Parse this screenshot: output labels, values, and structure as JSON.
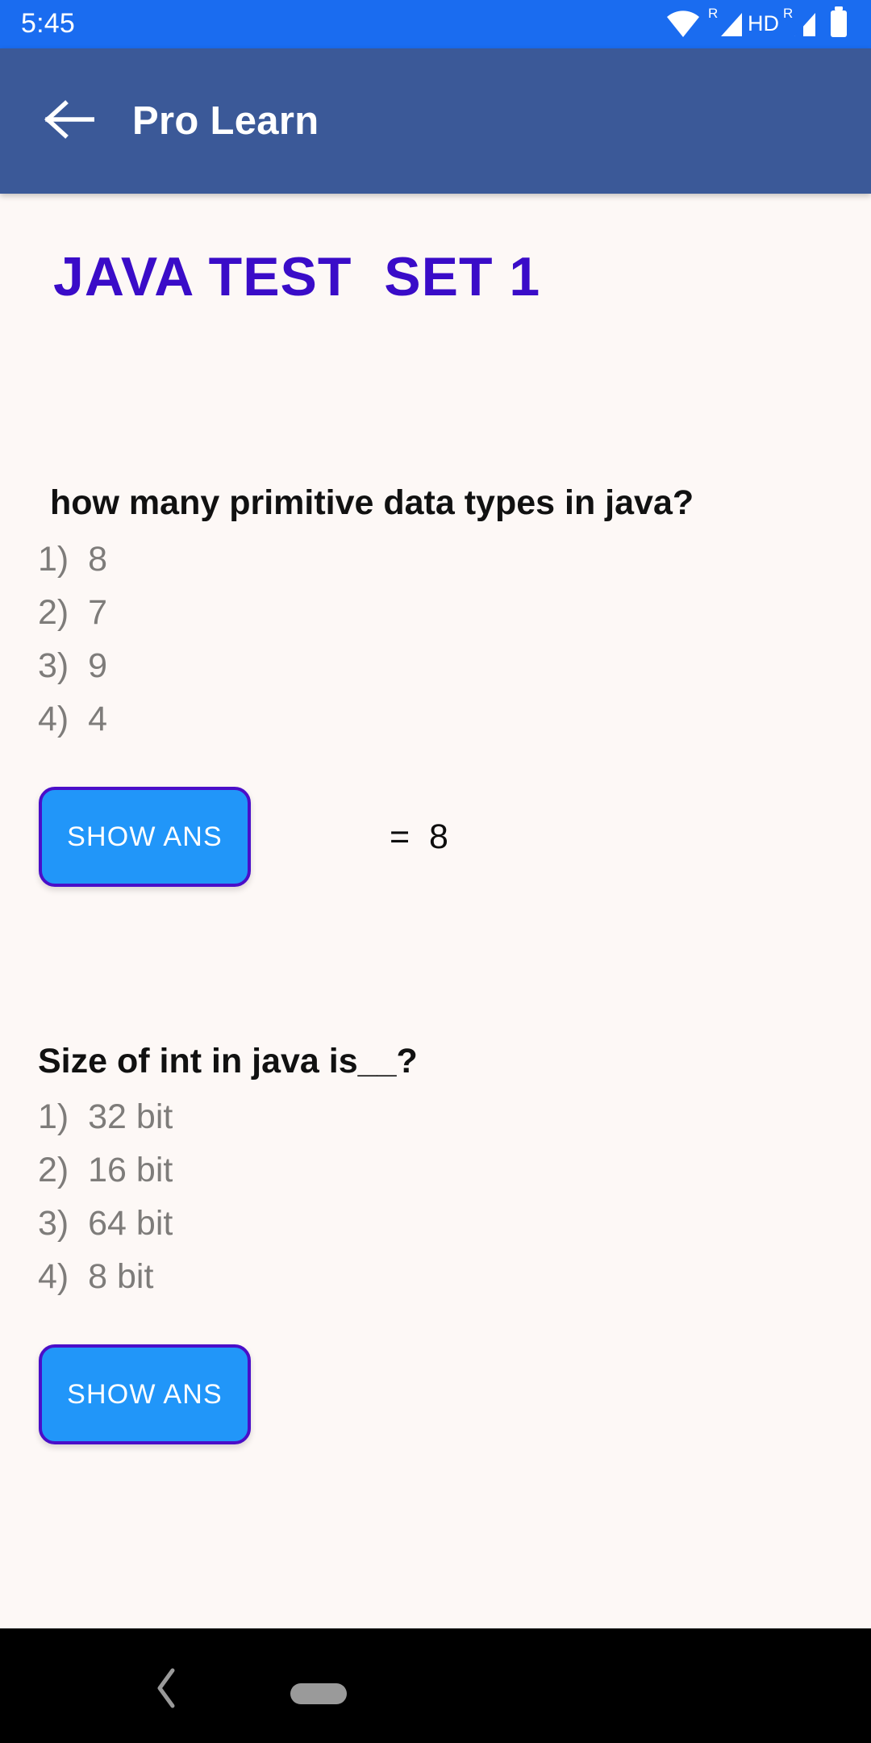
{
  "status_bar": {
    "time": "5:45",
    "hd_label": "HD",
    "roaming_label": "R",
    "icons": [
      "wifi-icon",
      "roaming-signal-icon",
      "hd-label",
      "roaming-signal-icon-2",
      "battery-icon"
    ]
  },
  "app_bar": {
    "back_icon": "arrow-left-icon",
    "title": "Pro Learn",
    "background_color": "#3b5998"
  },
  "page": {
    "test_title": "JAVA TEST  SET 1",
    "title_color": "#3a0cc8",
    "background_color": "#fdf8f6"
  },
  "questions": [
    {
      "text": "how many primitive data types in java?",
      "options": [
        "1)  8",
        "2)  7",
        "3)  9",
        "4)  4"
      ],
      "button_label": "SHOW ANS",
      "answer": "=  8",
      "answer_visible": true
    },
    {
      "text": "Size of int in java is__?",
      "options": [
        "1)  32 bit",
        "2)  16 bit",
        "3)  64 bit",
        "4)  8 bit"
      ],
      "button_label": "SHOW ANS",
      "answer": "",
      "answer_visible": false
    }
  ],
  "button_style": {
    "fill_color": "#2196f9",
    "border_color": "#4a0ec9",
    "text_color": "#ffffff"
  },
  "nav_bar": {
    "back_icon": "chevron-left-icon",
    "home_handle": "home-pill-icon",
    "background_color": "#000000"
  }
}
